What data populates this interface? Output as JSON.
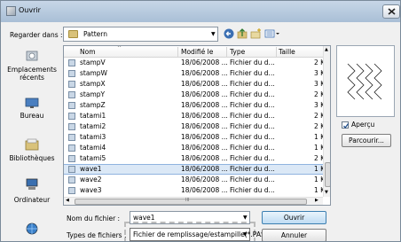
{
  "window": {
    "title": "Ouvrir",
    "icon": "app-icon",
    "close_icon": "close-icon"
  },
  "lookin": {
    "label": "Regarder dans :",
    "value": "Pattern",
    "icons": [
      "folder-icon",
      "chevron-down-icon",
      "back-icon",
      "up-folder-icon",
      "new-folder-icon",
      "view-menu-icon"
    ]
  },
  "places": [
    {
      "label": "Emplacements récents",
      "line1": "Emplacements",
      "line2": "récents",
      "icon": "recent-places-icon"
    },
    {
      "label": "Bureau",
      "icon": "desktop-icon"
    },
    {
      "label": "Bibliothèques",
      "icon": "libraries-icon"
    },
    {
      "label": "Ordinateur",
      "icon": "computer-icon"
    },
    {
      "label": "",
      "icon": "network-icon"
    }
  ],
  "columns": [
    "Nom",
    "Modifié le",
    "Type",
    "Taille"
  ],
  "files": [
    {
      "name": "stampV",
      "date": "18/06/2008 ...",
      "type": "Fichier du d...",
      "size": "2 K"
    },
    {
      "name": "stampW",
      "date": "18/06/2008 ...",
      "type": "Fichier du d...",
      "size": "3 K"
    },
    {
      "name": "stampX",
      "date": "18/06/2008 ...",
      "type": "Fichier du d...",
      "size": "3 K"
    },
    {
      "name": "stampY",
      "date": "18/06/2008 ...",
      "type": "Fichier du d...",
      "size": "2 K"
    },
    {
      "name": "stampZ",
      "date": "18/06/2008 ...",
      "type": "Fichier du d...",
      "size": "3 K"
    },
    {
      "name": "tatami1",
      "date": "18/06/2008 ...",
      "type": "Fichier du d...",
      "size": "2 K"
    },
    {
      "name": "tatami2",
      "date": "18/06/2008 ...",
      "type": "Fichier du d...",
      "size": "2 K"
    },
    {
      "name": "tatami3",
      "date": "18/06/2008 ...",
      "type": "Fichier du d...",
      "size": "1 K"
    },
    {
      "name": "tatami4",
      "date": "18/06/2008 ...",
      "type": "Fichier du d...",
      "size": "1 K"
    },
    {
      "name": "tatami5",
      "date": "18/06/2008 ...",
      "type": "Fichier du d...",
      "size": "2 K"
    },
    {
      "name": "wave1",
      "date": "18/06/2008 ...",
      "type": "Fichier du d...",
      "size": "1 K",
      "selected": true
    },
    {
      "name": "wave2",
      "date": "18/06/2008 ...",
      "type": "Fichier du d...",
      "size": "1 K"
    },
    {
      "name": "wave3",
      "date": "18/06/2008 ...",
      "type": "Fichier du d...",
      "size": "1 K"
    }
  ],
  "hscroll_label": "III",
  "preview": {
    "checkbox_label": "Aperçu",
    "checked": true,
    "browse_label": "Parcourir..."
  },
  "filename": {
    "label": "Nom du fichier :",
    "value": "wave1"
  },
  "filetype": {
    "label": "Types de fichiers :",
    "value": "Fichier de remplissage/estampille(*.PAS"
  },
  "buttons": {
    "open": "Ouvrir",
    "cancel": "Annuler"
  }
}
